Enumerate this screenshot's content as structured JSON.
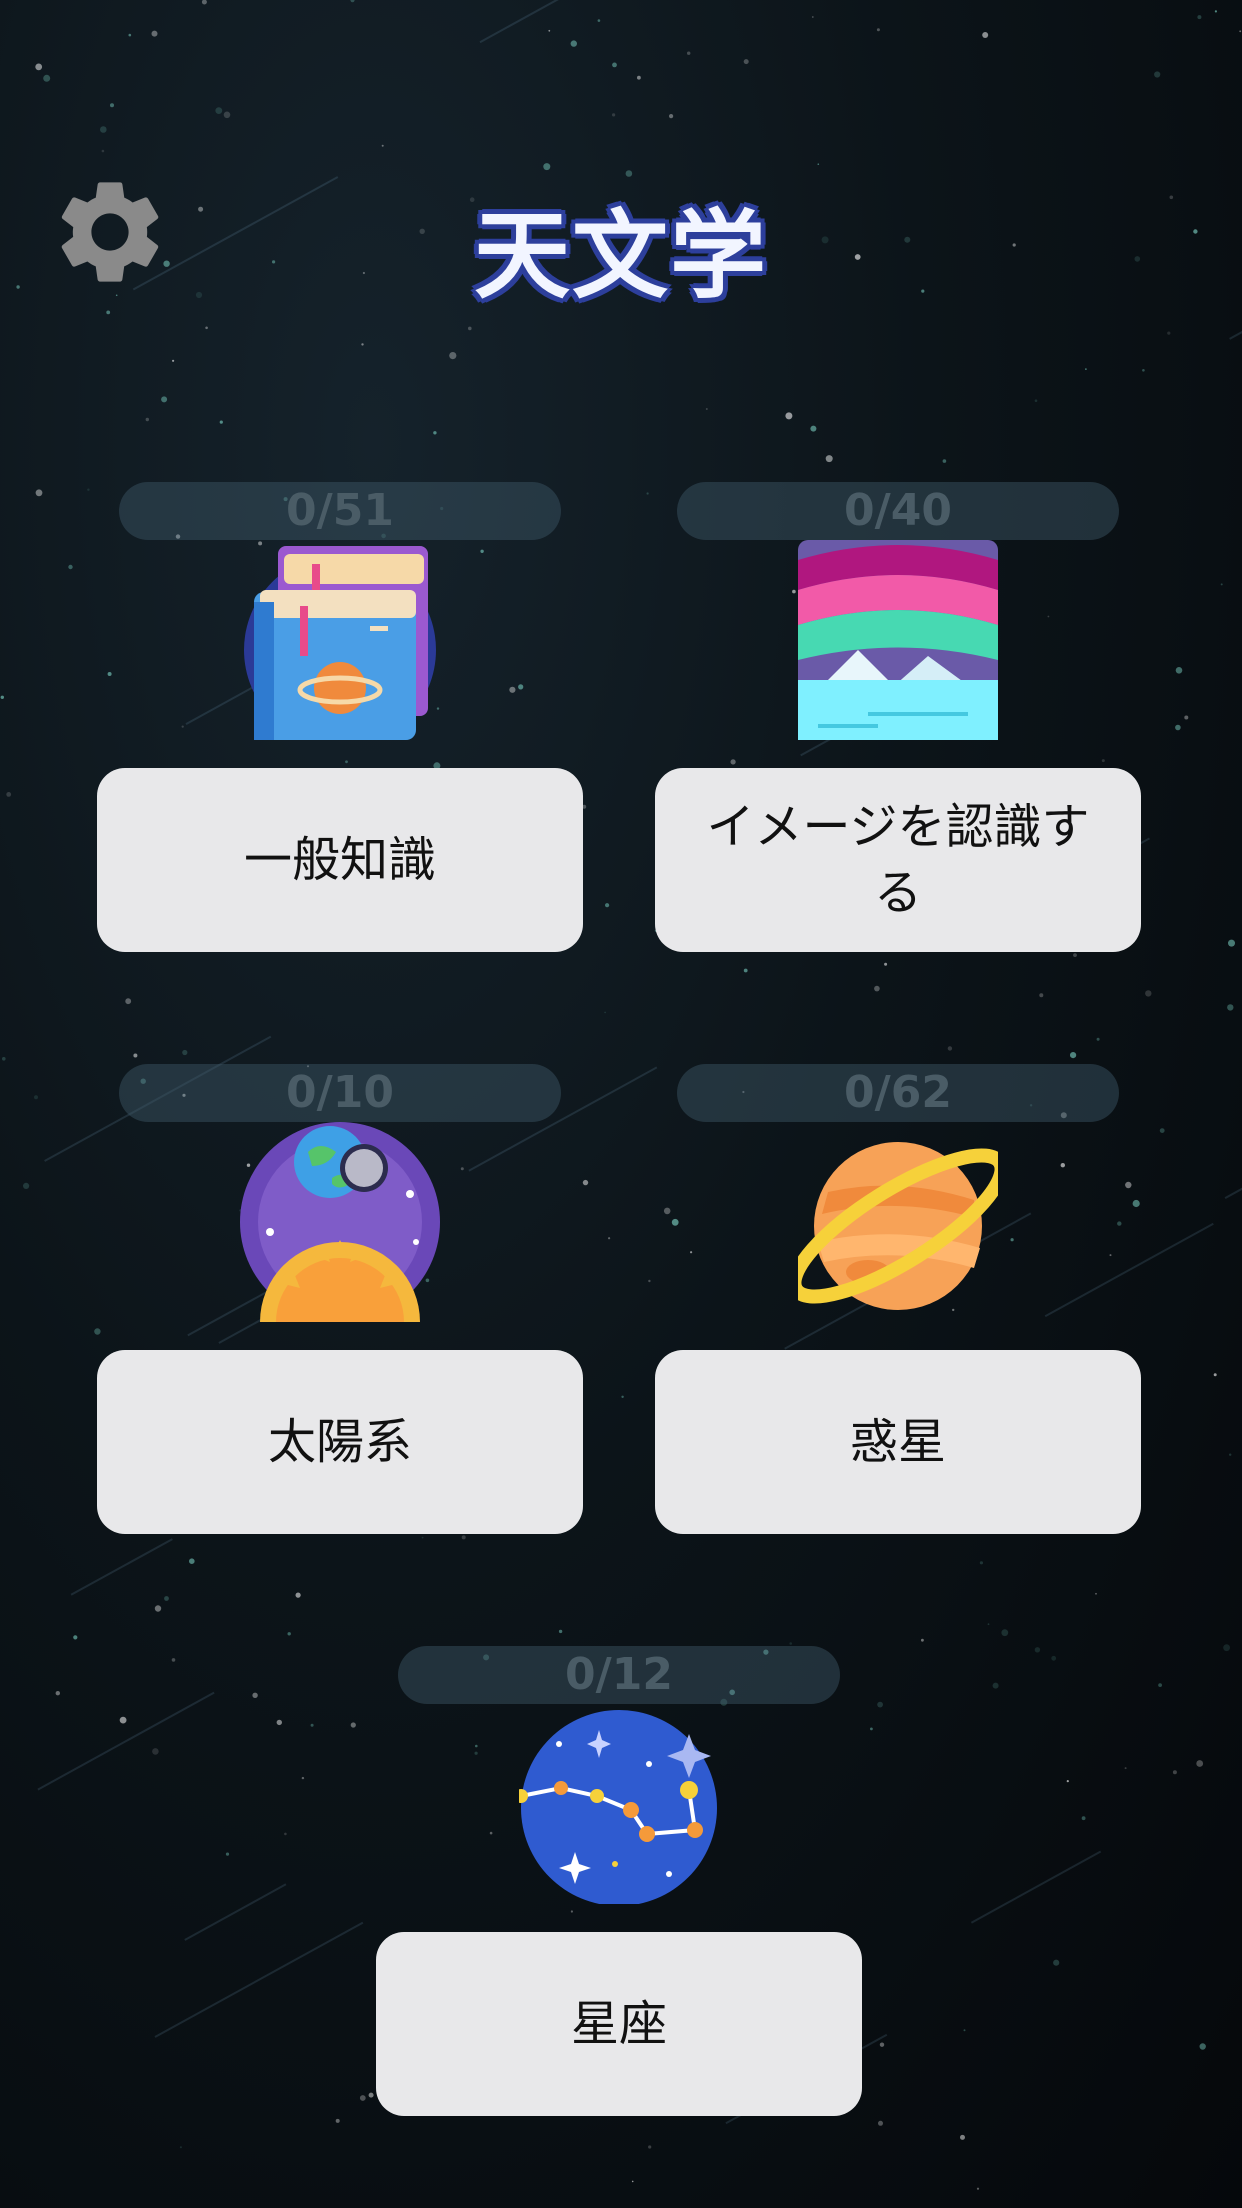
{
  "header": {
    "title": "天文学",
    "settings_icon": "gear-icon"
  },
  "categories": [
    {
      "label": "一般知識",
      "progress": "0/51",
      "icon": "books-planet-icon"
    },
    {
      "label": "イメージを認識する",
      "progress": "0/40",
      "icon": "aurora-landscape-icon"
    },
    {
      "label": "太陽系",
      "progress": "0/10",
      "icon": "sun-earth-moon-icon"
    },
    {
      "label": "惑星",
      "progress": "0/62",
      "icon": "ringed-planet-icon"
    },
    {
      "label": "星座",
      "progress": "0/12",
      "icon": "constellation-icon"
    }
  ],
  "colors": {
    "button_bg": "#e8e8ea",
    "title_outline": "#2d3f9c",
    "progress_text": "#4a5c66"
  }
}
